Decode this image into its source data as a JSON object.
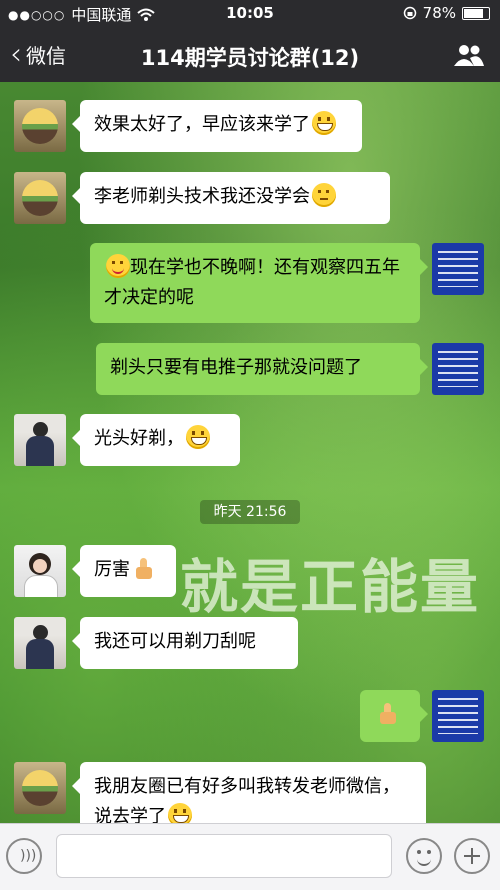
{
  "status_bar": {
    "carrier": "中国联通",
    "signal_dots": "●●○○○",
    "time": "10:05",
    "battery": "78%",
    "battery_level": 0.78
  },
  "nav": {
    "back_label": "微信",
    "title": "114期学员讨论群(12)"
  },
  "messages": [
    {
      "direction": "in",
      "avatar": "landscape",
      "text": "效果太好了，早应该来学了",
      "emoji": "grin"
    },
    {
      "direction": "in",
      "avatar": "landscape",
      "text": "李老师剃头技术我还没学会",
      "emoji": "think"
    },
    {
      "direction": "out",
      "avatar": "poster",
      "text": "现在学也不晚啊！还有观察四五年才决定的呢",
      "emoji_prefix": "smile"
    },
    {
      "direction": "out",
      "avatar": "poster",
      "text": "剃头只要有电推子那就没问题了"
    },
    {
      "direction": "in",
      "avatar": "person",
      "text": "光头好剃，",
      "emoji": "grin"
    },
    {
      "direction": "in",
      "avatar": "woman",
      "text": "厉害",
      "emoji": "thumbs-up"
    },
    {
      "direction": "in",
      "avatar": "person",
      "text": "我还可以用剃刀刮呢"
    },
    {
      "direction": "out",
      "avatar": "poster",
      "text": "",
      "emoji": "thumbs-up"
    },
    {
      "direction": "in",
      "avatar": "landscape",
      "text": "我朋友圈已有好多叫我转发老师微信，说去学了",
      "emoji": "grin"
    }
  ],
  "timestamp": "昨天 21:56",
  "wallpaper_text": "就是正能量",
  "colors": {
    "nav_bg": "#2b2b2e",
    "out_bubble": "#8fd95a",
    "in_bubble": "#ffffff"
  }
}
